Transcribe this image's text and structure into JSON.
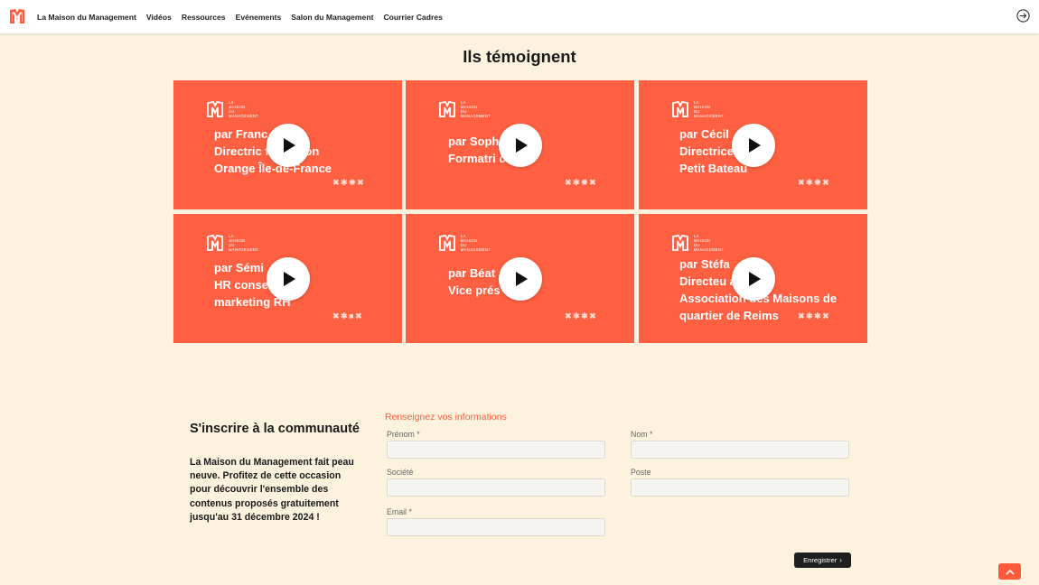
{
  "header": {
    "logo_icon": "maison-management-logo",
    "nav": [
      {
        "label": "La Maison du Management"
      },
      {
        "label": "Vidéos"
      },
      {
        "label": "Ressources"
      },
      {
        "label": "Evénements"
      },
      {
        "label": "Salon du Management"
      },
      {
        "label": "Courrier Cadres"
      }
    ],
    "login_icon": "login-arrow-icon"
  },
  "testimonials": {
    "title": "Ils témoignent",
    "brand_lines": [
      "LA",
      "MAISON",
      "DU",
      "MANAGEMENT"
    ],
    "cards": [
      {
        "lines": [
          "par Franc",
          "Directric        formation",
          "Orange Île-de-France"
        ],
        "marks": "✖✱✹✖"
      },
      {
        "lines": [
          "par Soph",
          "Formatri        coach"
        ],
        "marks": "✖✱✹✖"
      },
      {
        "lines": [
          "par Cécil",
          "Directrice        eting",
          "Petit Bateau"
        ],
        "marks": "✖✱✹✖"
      },
      {
        "lines": [
          "par Sémi",
          "HR conse        ets et",
          "marketing RH"
        ],
        "marks": "✖✱■✖"
      },
      {
        "lines": [
          "par Béat",
          "Vice prés        e Tax"
        ],
        "marks": "✖✱✱✖"
      },
      {
        "lines": [
          "par Stéfa",
          "Directeu        al",
          "Association des Maisons de",
          "quartier de Reims"
        ],
        "marks": "✖✱✱✖"
      }
    ]
  },
  "signup": {
    "title": "S'inscrire à la communauté",
    "description": "La Maison du Management fait peau neuve. Profitez de cette occasion pour découvrir l'ensemble des contenus proposés gratuitement jusqu'au 31 décembre 2024 !",
    "form_title": "Renseignez vos informations",
    "fields": {
      "prenom": {
        "label": "Prénom *",
        "value": ""
      },
      "nom": {
        "label": "Nom *",
        "value": ""
      },
      "societe": {
        "label": "Société",
        "value": ""
      },
      "poste": {
        "label": "Poste",
        "value": ""
      },
      "email": {
        "label": "Email *",
        "value": ""
      }
    },
    "submit_label": "Enregistrer"
  },
  "scroll_top_icon": "chevron-up-icon",
  "colors": {
    "accent": "#ff6041",
    "background": "#fdf2de",
    "button_dark": "#1f1f1f"
  }
}
